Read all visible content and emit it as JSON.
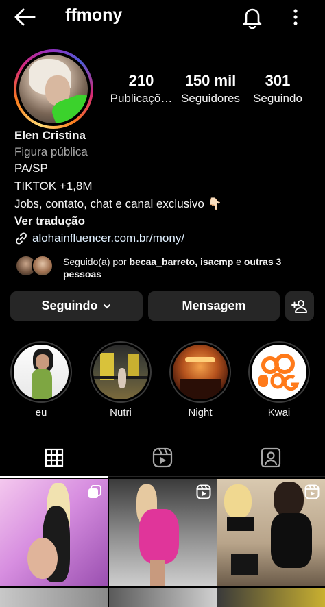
{
  "header": {
    "username": "ffmony",
    "back_icon": "arrow-left-icon",
    "notification_icon": "bell-icon",
    "more_icon": "more-vertical-icon"
  },
  "stats": [
    {
      "value": "210",
      "label": "Publicaçõ…"
    },
    {
      "value": "150 mil",
      "label": "Seguidores"
    },
    {
      "value": "301",
      "label": "Seguindo"
    }
  ],
  "bio": {
    "name": "Elen Cristina",
    "category": "Figura pública",
    "lines": [
      "PA/SP",
      "TIKTOK +1,8M",
      "Jobs, contato, chat e canal exclusivo 👇🏻"
    ],
    "translate": "Ver tradução",
    "link": "alohainfluencer.com.br/mony/"
  },
  "followed_by": {
    "prefix": "Seguido(a) por ",
    "names": "becaa_barreto, isacmp",
    "middle": " e ",
    "others": "outras 3 pessoas"
  },
  "actions": {
    "following_label": "Seguindo",
    "message_label": "Mensagem"
  },
  "highlights": [
    {
      "label": "eu"
    },
    {
      "label": "Nutri"
    },
    {
      "label": "Night"
    },
    {
      "label": "Kwai"
    }
  ],
  "tabs": {
    "grid_icon": "grid-icon",
    "reels_icon": "reels-icon",
    "tagged_icon": "tagged-icon"
  },
  "colors": {
    "background": "#000000",
    "button": "#262626",
    "muted_text": "#a8a8a8"
  }
}
